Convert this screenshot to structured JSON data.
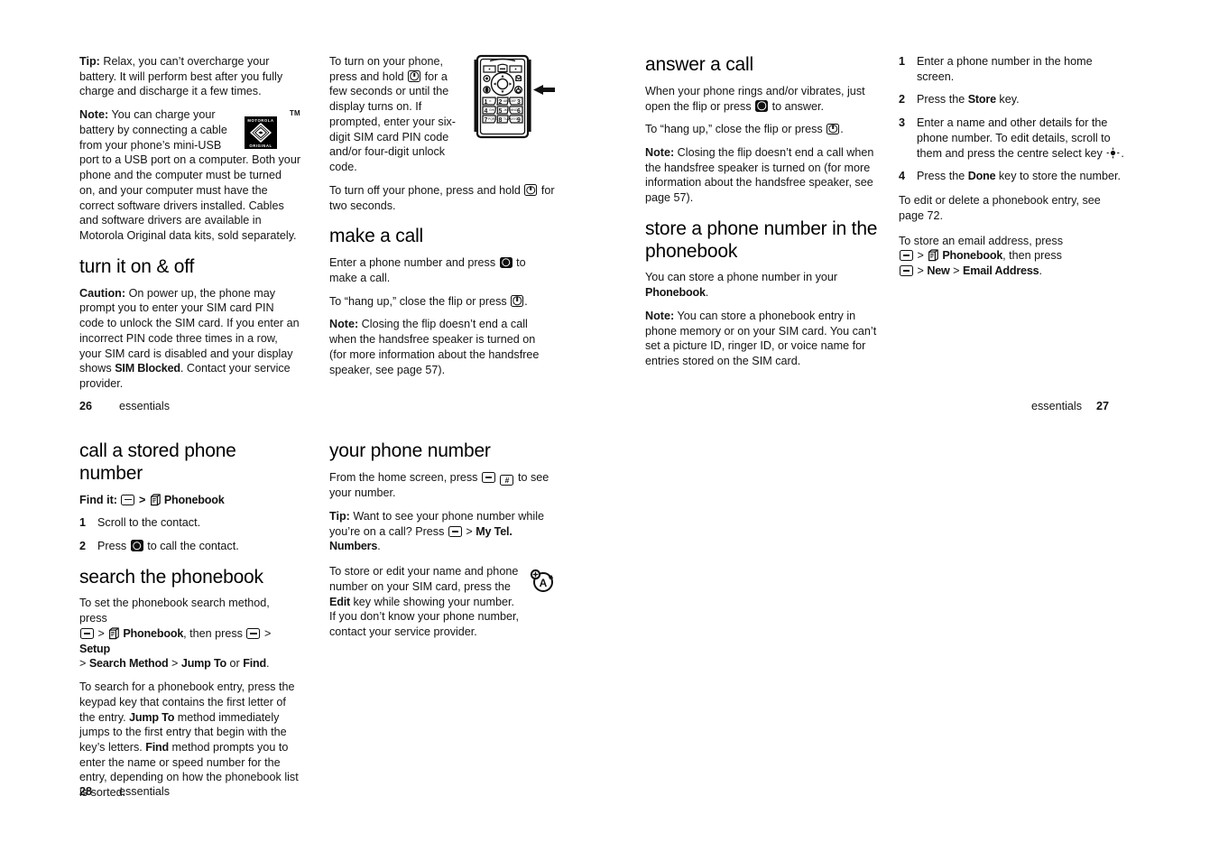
{
  "document": {
    "type": "user-guide-page-spread",
    "manual_brand": "MOTOROLA"
  },
  "logo": {
    "top_text": "MOTOROLA",
    "bottom_text": "ORIGINAL",
    "trademark": "TM"
  },
  "icons": {
    "menu_key": "menu-key-icon",
    "power_key": "power-key-icon",
    "call_key": "call-key-icon",
    "end_key": "end-key-icon",
    "hash_key": "hash-key-icon",
    "phonebook": "phonebook-icon",
    "centre_select_key": "centre-select-key-icon",
    "text_entry": "text-entry-a-icon",
    "phone_keypad": "phone-keypad-illustration",
    "pointer_arrow": "arrow-left-icon"
  },
  "page26": {
    "footer": {
      "page_number": "26",
      "label": "essentials"
    },
    "col1": {
      "tip": {
        "label": "Tip:",
        "text": " Relax, you can’t overcharge your battery. It will perform best after you fully charge and discharge it a few times."
      },
      "note": {
        "label": "Note:",
        "text": " You can charge your battery by connecting a cable from your phone’s mini-USB port to a USB port on a computer. Both your phone and the computer must be turned on, and your computer must have the correct software drivers installed. Cables and software drivers are available in Motorola Original data kits, sold separately."
      },
      "heading": "turn it on & off",
      "caution": {
        "label": "Caution:",
        "part1": " On power up, the phone may prompt you to enter your SIM card PIN code to unlock the SIM card. If you enter an incorrect PIN code three times in a row, your SIM card is disabled and your display shows ",
        "bold_term": "SIM Blocked",
        "part2": ". Contact your service provider."
      }
    },
    "col2": {
      "turn_on": {
        "part1": "To turn on your phone, press and hold ",
        "part2": " for a few seconds or until the display turns on. If prompted, enter your six-digit SIM card PIN code and/or four-digit unlock code."
      },
      "turn_off": {
        "part1": "To turn off your phone, press and hold ",
        "part2": " for two seconds."
      },
      "heading": "make a call",
      "make": {
        "part1": "Enter a phone number and press ",
        "part2": " to make a call."
      },
      "hangup": {
        "part1": "To “hang up,” close the flip or press ",
        "part2": "."
      },
      "note": {
        "label": "Note:",
        "text": " Closing the flip doesn’t end a call when the handsfree speaker is turned on (for more information about the handsfree speaker, see page 57)."
      }
    }
  },
  "page27": {
    "footer": {
      "page_number": "27",
      "label": "essentials"
    },
    "col3": {
      "heading_answer": "answer a call",
      "answer": {
        "part1": "When your phone rings and/or vibrates, just open the flip or press ",
        "part2": " to answer."
      },
      "hangup": {
        "part1": "To “hang up,” close the flip or press ",
        "part2": "."
      },
      "note": {
        "label": "Note:",
        "text": " Closing the flip doesn’t end a call when the handsfree speaker is turned on (for more information about the handsfree speaker, see page 57)."
      },
      "heading_store": "store a phone number in the phonebook",
      "store_intro": {
        "part1": "You can store a phone number in your ",
        "bold_term": "Phonebook",
        "part2": "."
      },
      "store_note": {
        "label": "Note:",
        "text": " You can store a phonebook entry in phone memory or on your SIM card. You can’t set a picture ID, ringer ID, or voice name for entries stored on the SIM card."
      }
    },
    "col4": {
      "steps": [
        {
          "num": "1",
          "text": "Enter a phone number in the home screen."
        },
        {
          "num": "2",
          "pre": "Press the ",
          "bold_term": "Store",
          "post": " key."
        },
        {
          "num": "3",
          "pre": "Enter a name and other details for the phone number. To edit details, scroll to them and press the centre select key ",
          "post": "."
        },
        {
          "num": "4",
          "pre": "Press the ",
          "bold_term": "Done",
          "post": " key to store the number."
        }
      ],
      "edit_delete": "To edit or delete a phonebook entry, see page 72.",
      "email": {
        "line1": "To store an email address, press",
        "phonebook_label": "Phonebook",
        "line2_tail": ", then press",
        "new_label": "New",
        "email_label": "Email Address",
        "gt": ">"
      }
    }
  },
  "page28": {
    "footer": {
      "page_number": "28",
      "label": "essentials"
    },
    "col1": {
      "heading": "call a stored phone number",
      "find_it_label": "Find it:",
      "find_it_gt": ">",
      "find_it_target": "Phonebook",
      "steps": [
        {
          "num": "1",
          "text": "Scroll to the contact."
        },
        {
          "num": "2",
          "pre": "Press ",
          "post": " to call the contact."
        }
      ],
      "heading_search": "search the phonebook",
      "search_method": {
        "line1": "To set the phonebook search method, press",
        "phonebook_label": "Phonebook",
        "then_press": ", then press",
        "setup_label": "Setup",
        "search_method_label": "Search Method",
        "jump_to_label": "Jump To",
        "or": "or",
        "find_label": "Find",
        "gt": ">",
        "period": "."
      },
      "search_desc": {
        "part1": "To search for a phonebook entry, press the keypad key that contains the first letter of the entry. ",
        "bold1": "Jump To",
        "part2": " method immediately jumps to the first entry that begin with the key’s letters. ",
        "bold2": "Find",
        "part3": " method prompts you to enter the name or speed number for the entry, depending on how the phonebook list is sorted."
      }
    },
    "col2": {
      "heading": "your phone number",
      "home_screen": {
        "part1": "From the home screen, press ",
        "part2": " to see your number."
      },
      "tip": {
        "label": "Tip:",
        "part1": " Want to see your phone number while you’re on a call? Press ",
        "gt": ">",
        "bold_term": "My Tel. Numbers",
        "part2": "."
      },
      "store_edit": {
        "part1": "To store or edit your name and phone number on your SIM card, press the ",
        "bold_term": "Edit",
        "part2": " key while showing your number. If you don’t know your phone number, contact your service provider."
      }
    }
  }
}
